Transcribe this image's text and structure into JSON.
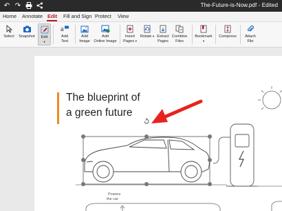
{
  "titlebar": {
    "doc_title": "The-Future-is-Now.pdf - Edited",
    "icons": [
      "undo-icon",
      "redo-icon",
      "print-icon",
      "share-icon"
    ]
  },
  "tabs": [
    {
      "label": "Home",
      "active": false
    },
    {
      "label": "Annotate",
      "active": false
    },
    {
      "label": "Edit",
      "active": true
    },
    {
      "label": "Fill and Sign",
      "active": false
    },
    {
      "label": "Protect",
      "active": false
    },
    {
      "label": "View",
      "active": false
    }
  ],
  "ribbon": {
    "select": "Select",
    "snapshot": "Snapshot",
    "edit": "Edit",
    "add_text_1": "Add",
    "add_text_2": "Text",
    "add_image_1": "Add",
    "add_image_2": "Image",
    "add_online_image_1": "Add",
    "add_online_image_2": "Online Image",
    "insert_pages_1": "Insert",
    "insert_pages_2": "Pages",
    "rotate_1": "Rotate",
    "extract_pages_1": "Extract",
    "extract_pages_2": "Pages",
    "combine_files_1": "Combine",
    "combine_files_2": "Files",
    "bookmark_1": "Bookmark",
    "compress": "Compress",
    "attach_file_1": "Attach",
    "attach_file_2": "File"
  },
  "document": {
    "headline_line1": "The blueprint of",
    "headline_line2": "a green future",
    "caption_line1": "Powers",
    "caption_line2": "the car"
  },
  "colors": {
    "accent": "#b5182a",
    "orange_bar": "#f0881f",
    "arrow": "#e8231d",
    "titlebar": "#2a2a2a"
  }
}
